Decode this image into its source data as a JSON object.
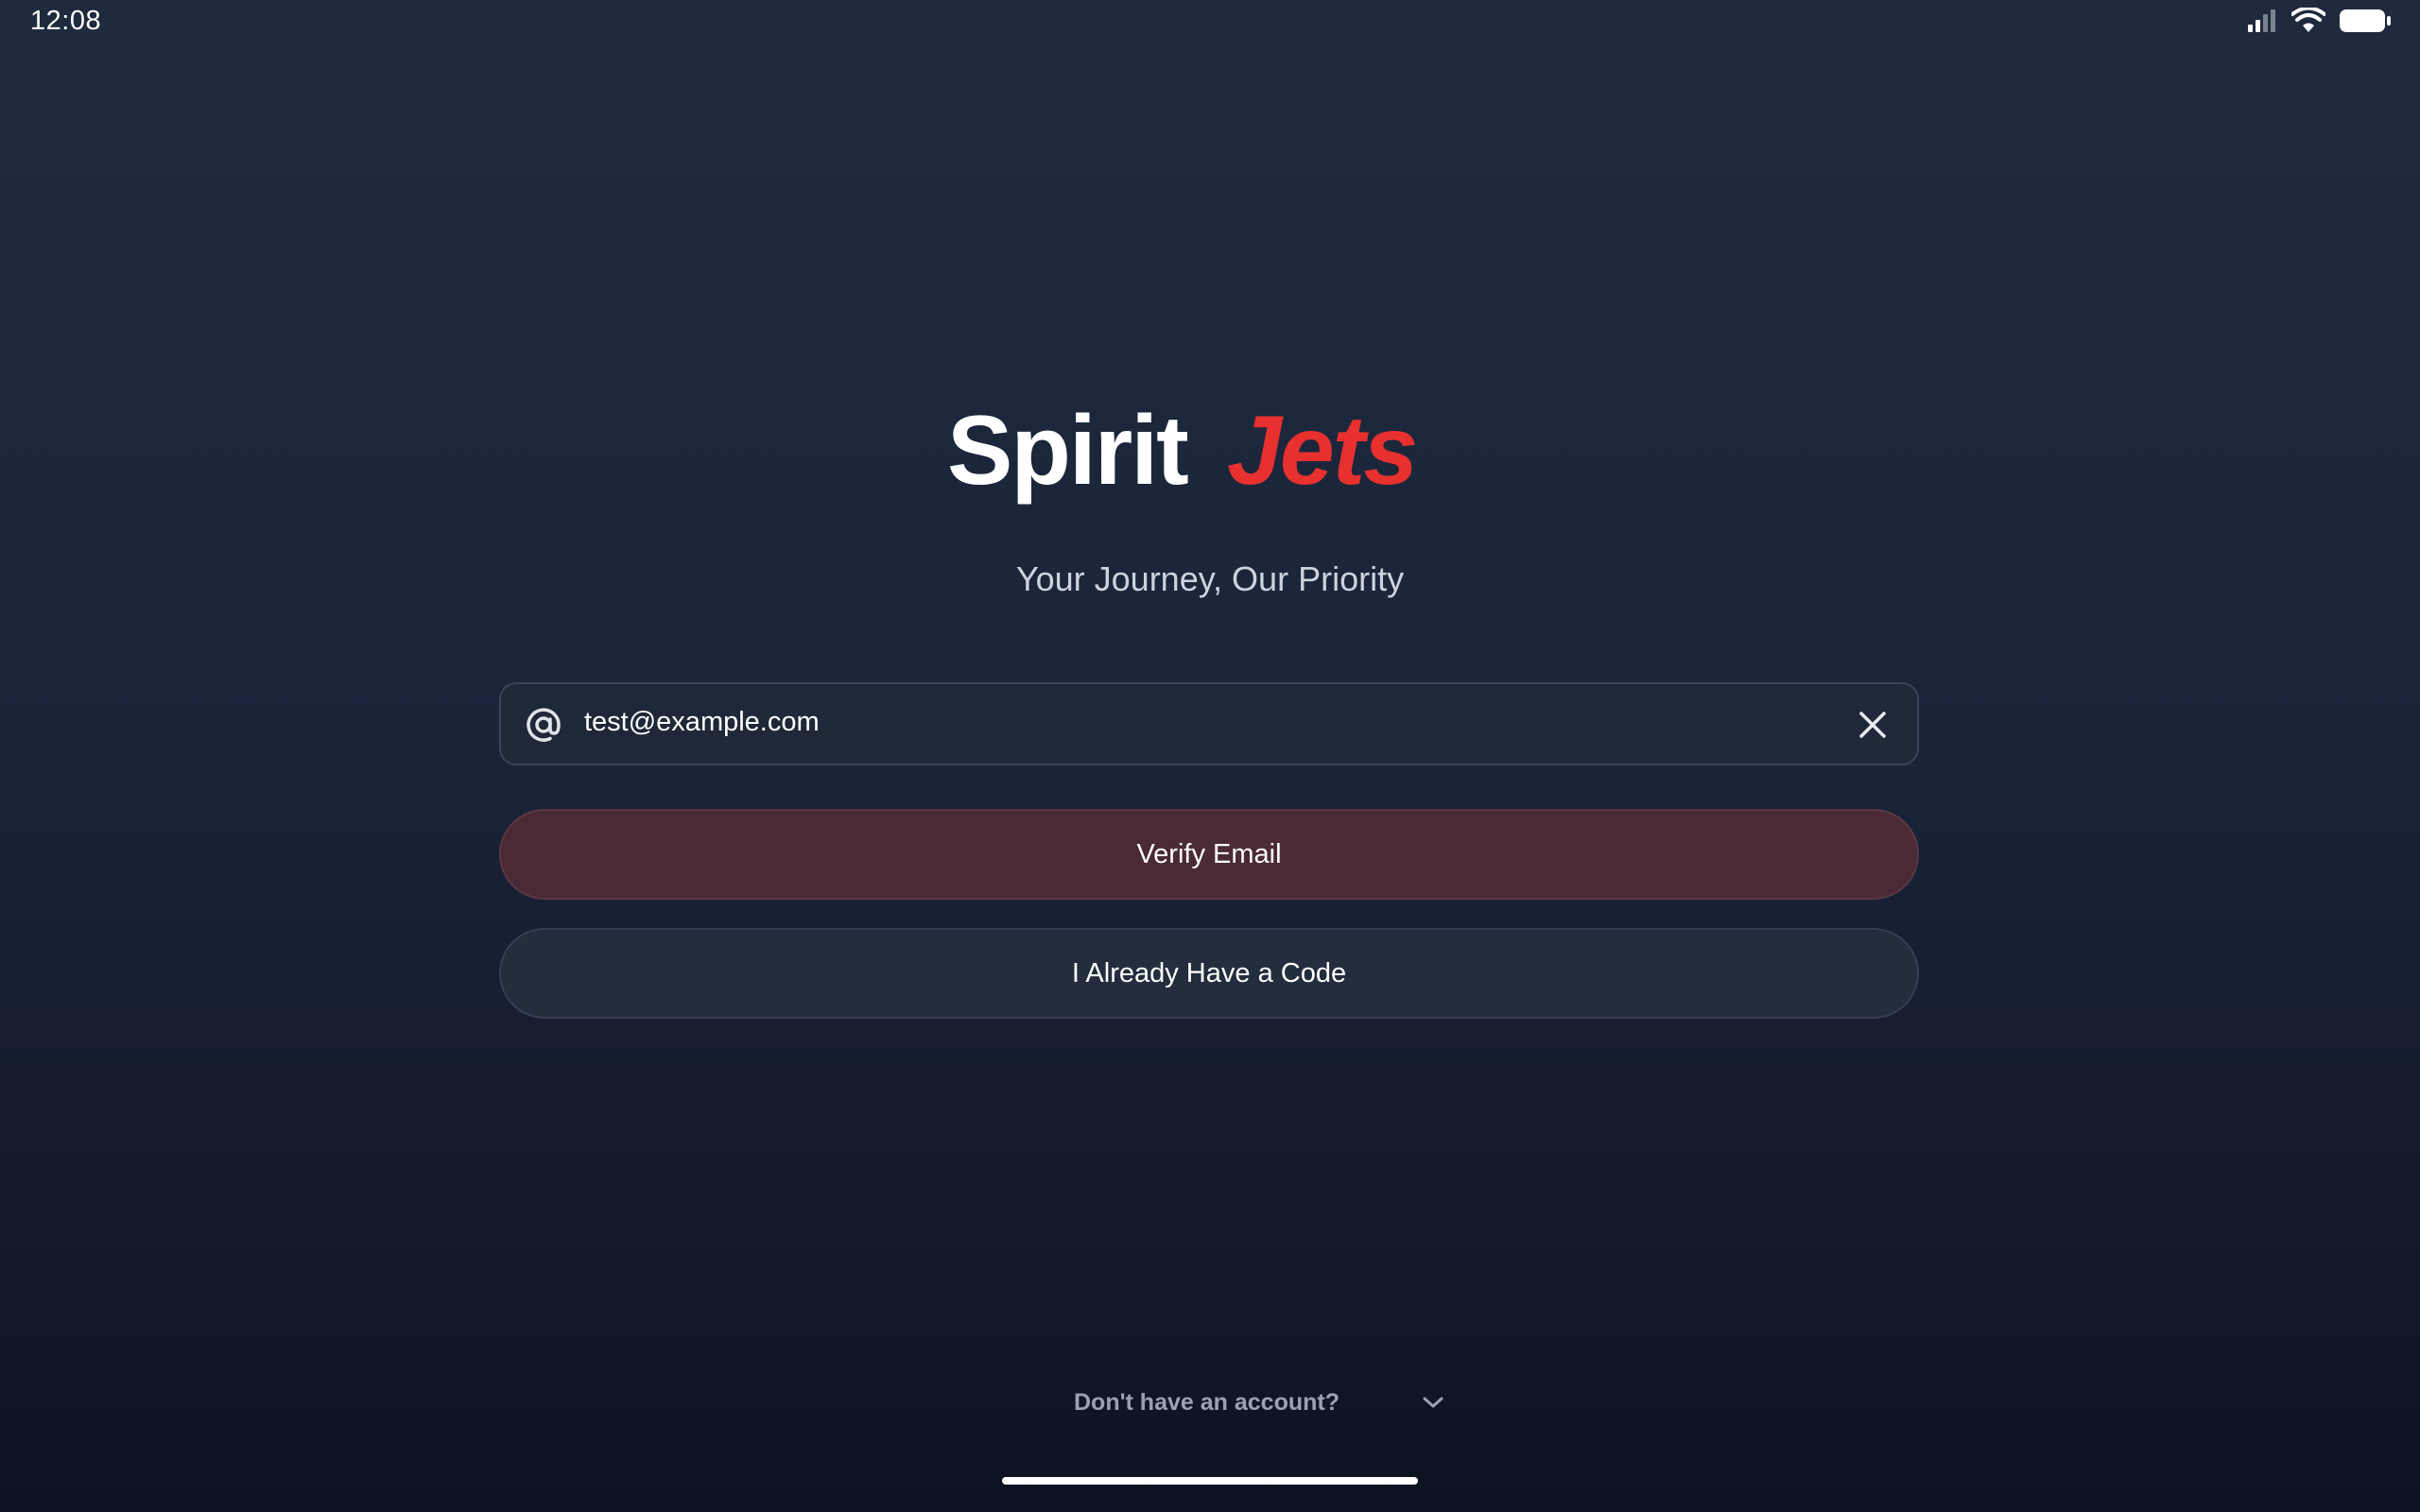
{
  "status_bar": {
    "time": "12:08",
    "icons": [
      "cellular-signal-icon",
      "wifi-icon",
      "battery-icon"
    ]
  },
  "brand": {
    "logo_text_primary": "Spirit",
    "logo_text_accent": "Jets",
    "primary_color": "#ffffff",
    "accent_color": "#e8312f",
    "tagline": "Your Journey, Our Priority"
  },
  "email_field": {
    "icon": "at-sign-icon",
    "value": "test@example.com",
    "clear_icon": "close-icon"
  },
  "buttons": {
    "verify": "Verify Email",
    "have_code": "I Already Have a Code"
  },
  "signup": {
    "label": "Don't have an account?",
    "icon": "chevron-down-icon"
  },
  "colors": {
    "verify_button_bg": "#4a2a36",
    "secondary_button_bg": "#232d3d",
    "background_top": "#1f2a3e",
    "background_bottom": "#0c1220"
  }
}
